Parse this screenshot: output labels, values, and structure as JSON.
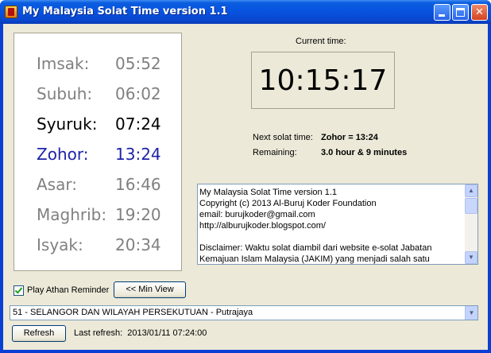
{
  "window": {
    "title": "My Malaysia Solat Time version 1.1",
    "minimize_icon": "minimize-icon",
    "maximize_icon": "maximize-icon",
    "close_icon": "close-icon"
  },
  "prayer_times": [
    {
      "name": "Imsak:",
      "time": "05:52",
      "color": "#808080",
      "weight": "normal"
    },
    {
      "name": "Subuh:",
      "time": "06:02",
      "color": "#808080",
      "weight": "normal"
    },
    {
      "name": "Syuruk:",
      "time": "07:24",
      "color": "#000000",
      "weight": "normal"
    },
    {
      "name": "Zohor:",
      "time": "13:24",
      "color": "#1d23a8",
      "weight": "normal"
    },
    {
      "name": "Asar:",
      "time": "16:46",
      "color": "#808080",
      "weight": "normal"
    },
    {
      "name": "Maghrib:",
      "time": "19:20",
      "color": "#808080",
      "weight": "normal"
    },
    {
      "name": "Isyak:",
      "time": "20:34",
      "color": "#808080",
      "weight": "normal"
    }
  ],
  "clock": {
    "label": "Current time:",
    "value": "10:15:17"
  },
  "next": {
    "label": "Next solat time:",
    "value": "Zohor = 13:24",
    "remaining_label": "Remaining:",
    "remaining_value": "3.0 hour & 9 minutes"
  },
  "info_lines": [
    "My Malaysia Solat Time version 1.1",
    "Copyright (c) 2013 Al-Buruj Koder Foundation",
    "email: burujkoder@gmail.com",
    "http://alburujkoder.blogspot.com/",
    "",
    "Disclaimer: Waktu solat diambil dari website e-solat Jabatan",
    "Kemajuan Islam Malaysia (JAKIM) yang menjadi salah satu"
  ],
  "controls": {
    "play_athan_label": "Play Athan Reminder",
    "play_athan_checked": true,
    "min_view_label": "<< Min View",
    "zone_selected": "51 - SELANGOR DAN WILAYAH PERSEKUTUAN - Putrajaya",
    "refresh_label": "Refresh",
    "last_refresh_label": "Last refresh:",
    "last_refresh_value": "2013/01/11 07:24:00"
  }
}
